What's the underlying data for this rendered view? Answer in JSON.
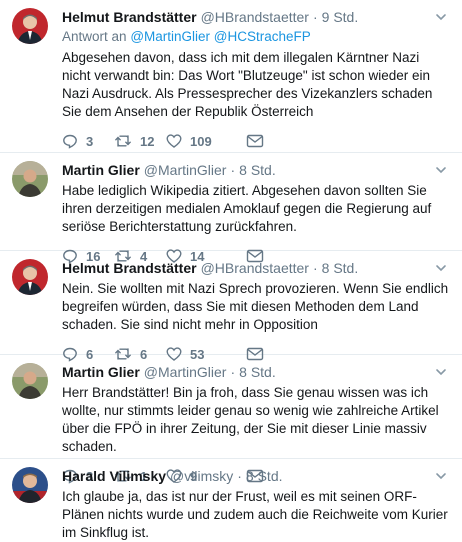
{
  "tweets": [
    {
      "name": "Helmut Brandstätter",
      "handle": "@HBrandstaetter",
      "time": "9 Std.",
      "reply_prefix": "Antwort an",
      "reply_mentions": "@MartinGlier @HCStracheFP",
      "text": "Abgesehen davon, dass ich mit dem illegalen Kärntner Nazi nicht verwandt bin: Das Wort \"Blutzeuge\" ist schon wieder ein Nazi Ausdruck. Als Pressesprecher des Vizekanzlers schaden Sie dem Ansehen der Republik Österreich",
      "replies": "3",
      "retweets": "12",
      "likes": "109",
      "avatar": "hb"
    },
    {
      "name": "Martin Glier",
      "handle": "@MartinGlier",
      "time": "8 Std.",
      "text": "Habe lediglich Wikipedia zitiert. Abgesehen davon sollten Sie ihren derzeitigen medialen Amoklauf gegen die Regierung auf seriöse Berichterstattung zurückfahren.",
      "replies": "16",
      "retweets": "4",
      "likes": "14",
      "avatar": "mg"
    },
    {
      "name": "Helmut Brandstätter",
      "handle": "@HBrandstaetter",
      "time": "8 Std.",
      "text": "Nein. Sie wollten mit Nazi Sprech provozieren. Wenn Sie endlich begreifen würden, dass Sie mit diesen Methoden dem Land schaden. Sie sind nicht mehr in Opposition",
      "replies": "6",
      "retweets": "6",
      "likes": "53",
      "avatar": "hb"
    },
    {
      "name": "Martin Glier",
      "handle": "@MartinGlier",
      "time": "8 Std.",
      "text": "Herr Brandstätter! Bin ja froh, dass Sie genau wissen was ich wollte, nur stimmts leider genau so wenig wie zahlreiche Artikel über die FPÖ in ihrer Zeitung, der Sie mit dieser Linie massiv schaden.",
      "replies": "3",
      "retweets": "1",
      "likes": "9",
      "avatar": "mg"
    },
    {
      "name": "Harald Vilimsky",
      "handle": "@vilimsky",
      "time": "8 Std.",
      "text": "Ich glaube ja, das ist nur der Frust, weil es mit seinen ORF-Plänen nichts wurde und zudem auch die Reichweite vom Kurier im Sinkflug ist.",
      "avatar": "hv"
    }
  ],
  "colors": {
    "text": "#14171a",
    "muted": "#657786",
    "link": "#1b95e0",
    "divider": "#e6ecf0"
  }
}
